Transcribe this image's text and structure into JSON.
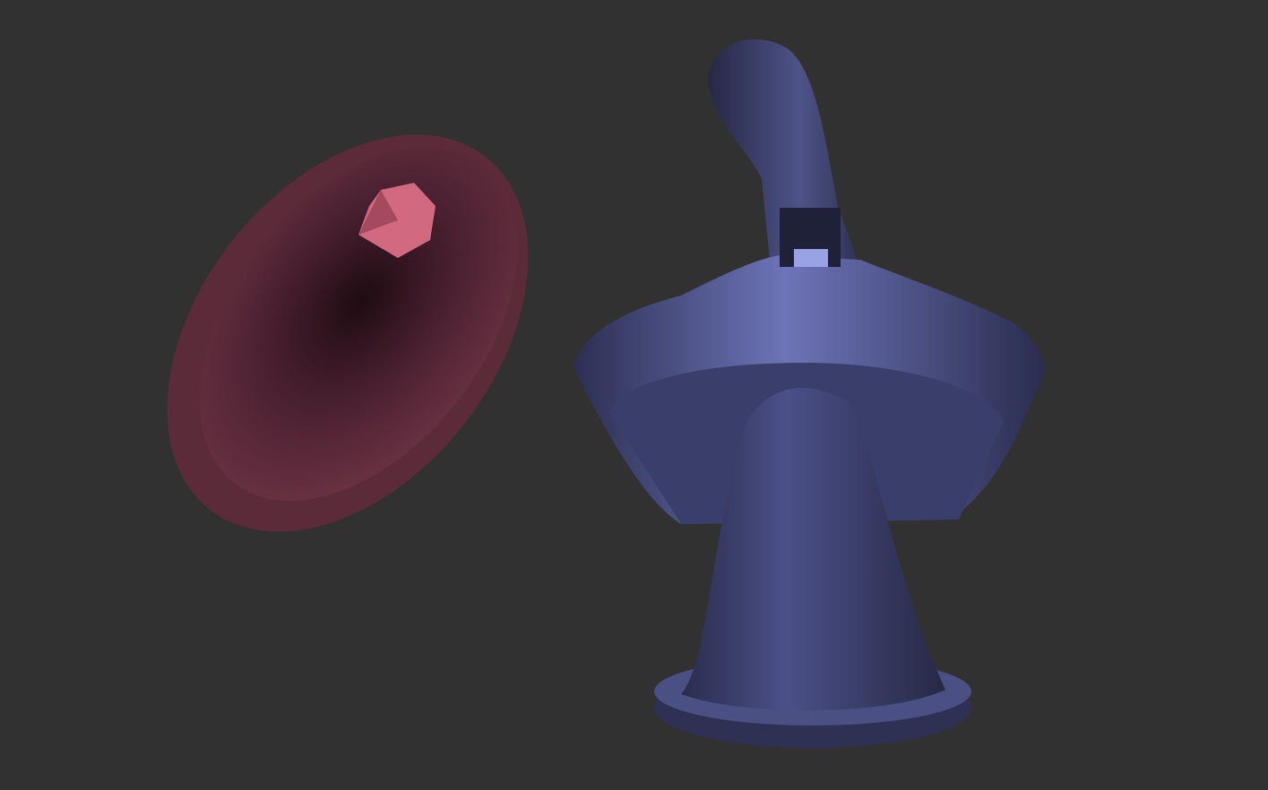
{
  "viewport": {
    "background_color": "#313131",
    "objects": [
      {
        "name": "shell-mesh",
        "color": "#5a2a38",
        "highlight_color": "#e07a8e"
      },
      {
        "name": "bust-mesh",
        "color": "#3e4270",
        "highlight_color": "#8d95d8"
      }
    ]
  }
}
